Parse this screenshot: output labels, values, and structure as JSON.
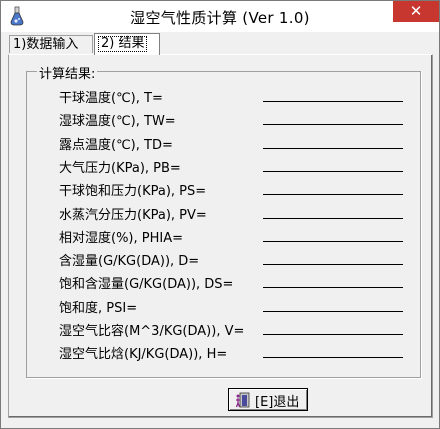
{
  "window": {
    "title": "湿空气性质计算 (Ver 1.0)",
    "close_symbol": "✕"
  },
  "tabs": [
    {
      "label": "1)数据输入"
    },
    {
      "label": "2) 结果"
    }
  ],
  "results": {
    "group_title": "计算结果:",
    "rows": [
      {
        "label": "干球温度(℃), T="
      },
      {
        "label": "湿球温度(℃), TW="
      },
      {
        "label": "露点温度(℃), TD="
      },
      {
        "label": "大气压力(KPa), PB="
      },
      {
        "label": "干球饱和压力(KPa), PS="
      },
      {
        "label": "水蒸汽分压力(KPa), PV="
      },
      {
        "label": "相对湿度(%), PHIA="
      },
      {
        "label": "含湿量(G/KG(DA)), D="
      },
      {
        "label": "饱和含湿量(G/KG(DA)), DS="
      },
      {
        "label": "饱和度, PSI="
      },
      {
        "label": "湿空气比容(M^3/KG(DA)), V="
      },
      {
        "label": "湿空气比焓(KJ/KG(DA)), H="
      }
    ]
  },
  "exit_button": {
    "label": "[E]退出"
  }
}
